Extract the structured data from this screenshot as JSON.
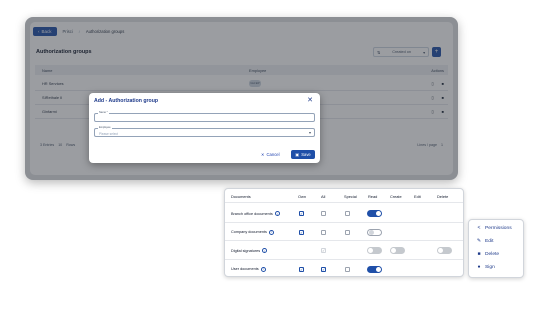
{
  "topbar": {
    "back_label": "Back",
    "crumb_1": "Prisci",
    "crumb_2": "Authorization groups"
  },
  "page": {
    "title": "Authorization groups",
    "sort_label": "Created on",
    "add_icon": "+"
  },
  "table": {
    "headers": {
      "name": "Name",
      "employee": "Employee",
      "actions": "Actions"
    },
    "rows": [
      {
        "name": "HR Services",
        "employee": "GH EP"
      },
      {
        "name": "SIRethale II",
        "employee": ""
      },
      {
        "name": "Ginfarmi",
        "employee": ""
      }
    ]
  },
  "pager": {
    "left_text": "3 Entries",
    "per_page": "10",
    "range": "Rows",
    "right_text": "Lines / page",
    "right_num": "1"
  },
  "modal": {
    "title": "Add - Authorization group",
    "name_label": "Name *",
    "employee_label": "Employee",
    "employee_placeholder": "Please select",
    "cancel_label": "Cancel",
    "save_label": "Save"
  },
  "permissions": {
    "headers": {
      "documents": "Documents",
      "own": "Own",
      "all": "All",
      "special": "Special",
      "read": "Read",
      "create": "Create",
      "edit": "Edit",
      "delete": "Delete"
    },
    "rows": [
      {
        "label": "Branch office documents"
      },
      {
        "label": "Company documents"
      },
      {
        "label": "Digital signatures"
      },
      {
        "label": "User documents"
      }
    ]
  },
  "menu": {
    "items": [
      {
        "label": "Permissions",
        "icon": "share-icon"
      },
      {
        "label": "Edit",
        "icon": "pencil-icon"
      },
      {
        "label": "Delete",
        "icon": "trash-icon"
      },
      {
        "label": "Sign",
        "icon": "sign-icon"
      }
    ]
  },
  "colors": {
    "accent": "#1f4fa8",
    "overlay": "#2d323a"
  }
}
